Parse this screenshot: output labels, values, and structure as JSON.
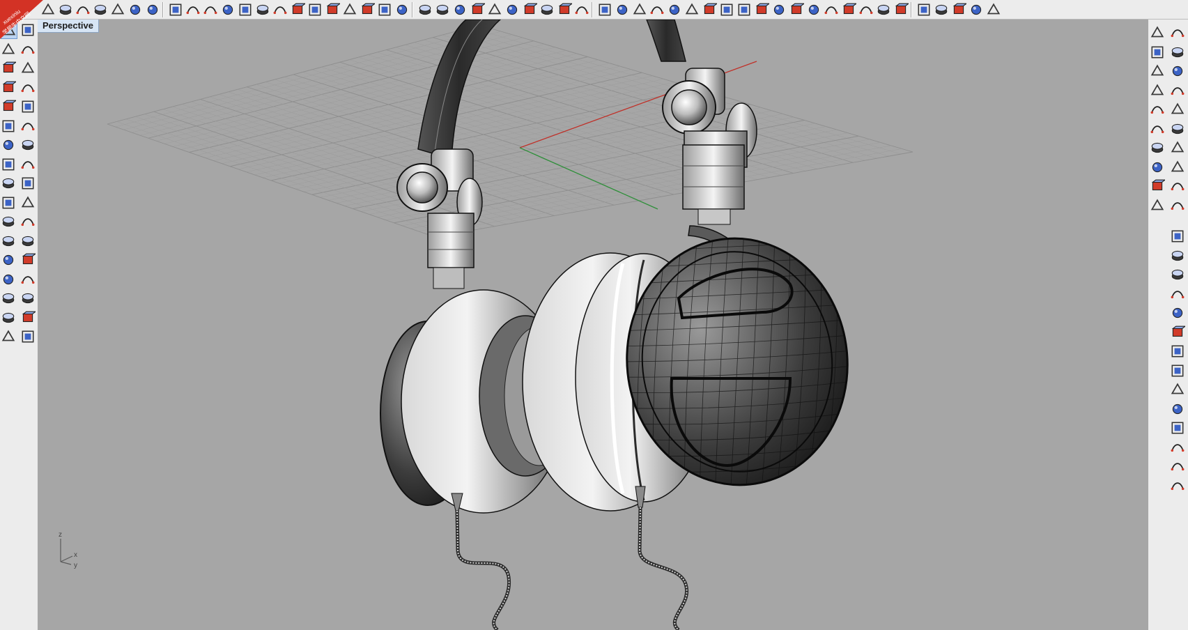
{
  "viewport": {
    "label": "Perspective",
    "axes": {
      "x": "x",
      "y": "y",
      "z": "z"
    }
  },
  "watermark": {
    "line1": "xuexiniu",
    "line2": "学犀牛中文网"
  },
  "colors": {
    "toolbar_bg": "#ececec",
    "viewport_bg": "#a6a6a6",
    "label_bg": "#d7e5f5",
    "x_axis": "#c03028",
    "y_axis": "#2f8f3a",
    "icon_blue": "#3c63c6",
    "icon_red": "#d13b2a"
  },
  "toolbar": {
    "icons": [
      "new-icon",
      "save-icon",
      "print-icon",
      "import-icon",
      "cut-icon",
      "copy-icon",
      "paste-icon",
      "undo-icon",
      "pan-icon",
      "rotate-view-icon",
      "zoom-icon",
      "zoom-window-icon",
      "zoom-extents-icon",
      "zoom-selected-icon",
      "undo-view-icon",
      "four-viewports-icon",
      "car-icon",
      "grid-icon",
      "object-snap-icon",
      "light-bulb-icon",
      "bulb-off-icon",
      "lock-icon",
      "layer-icon",
      "color-wheel-icon",
      "wireframe-sphere-icon",
      "render-sphere-icon",
      "shaded-sphere-icon",
      "spotlight-icon",
      "gear-icon",
      "dimension-icon",
      "help-icon",
      "cylinder-icon",
      "cylinder-2-icon",
      "plane-icon",
      "surface-icon",
      "box-icon",
      "surface-edit-icon",
      "surface-split-icon",
      "surface-join-icon",
      "network-surface-icon",
      "patch-icon",
      "blend-icon",
      "purple-surface-icon",
      "cube-icon",
      "mesh-icon",
      "point-cloud-icon",
      "texture-icon",
      "solid-icon",
      "box-edit-icon",
      "viewport-1-icon",
      "viewport-2-icon",
      "viewport-3-icon",
      "viewport-4-icon",
      "viewport-5-icon"
    ]
  },
  "left_panel": {
    "icons": [
      "point-icon",
      "select-icon",
      "polyline-icon",
      "curve-icon",
      "circle-icon",
      "circle-3pt-icon",
      "arc-icon",
      "rectangle-icon",
      "polygon-icon",
      "fillet-icon",
      "ellipse-icon",
      "revolve-icon",
      "box-icon",
      "solid-icon",
      "cylinder-icon",
      "surface-icon",
      "explode-icon",
      "boolean-icon",
      "split-icon",
      "trim-icon",
      "group-icon",
      "array-icon",
      "curve-tools-icon",
      "bend-icon",
      "text-icon",
      "scale-icon",
      "align-icon",
      "mirror-icon",
      "block-icon",
      "grid-snap-icon",
      "model-icon",
      "layout-icon",
      "dots-icon",
      "window-icon"
    ]
  },
  "right_panel": {
    "icons": [
      "render-icon",
      "render-2-icon",
      "render-3-icon",
      "render-4-icon",
      "light-icon",
      "light-2-icon",
      "light-3-icon",
      "light-4-icon",
      "material-icon",
      "material-2-icon",
      "solid-union-icon",
      "solid-diff-icon",
      "solid-intersect-icon",
      "solid-split-icon",
      "cube-icon",
      "shell-icon",
      "layers-icon",
      "extrude-icon",
      "cube-2-icon",
      "cube-3-icon",
      "cube-4-icon",
      "sphere-icon",
      "ellipsoid-icon",
      "paraboloid-icon",
      "cone-icon",
      "pyramid-icon",
      "truncated-cone-icon",
      "cylinder-icon",
      "tube-icon",
      "torus-icon",
      "pipe-icon",
      "pipe-2-icon",
      "box-3-icon",
      "text-solid-icon"
    ]
  }
}
